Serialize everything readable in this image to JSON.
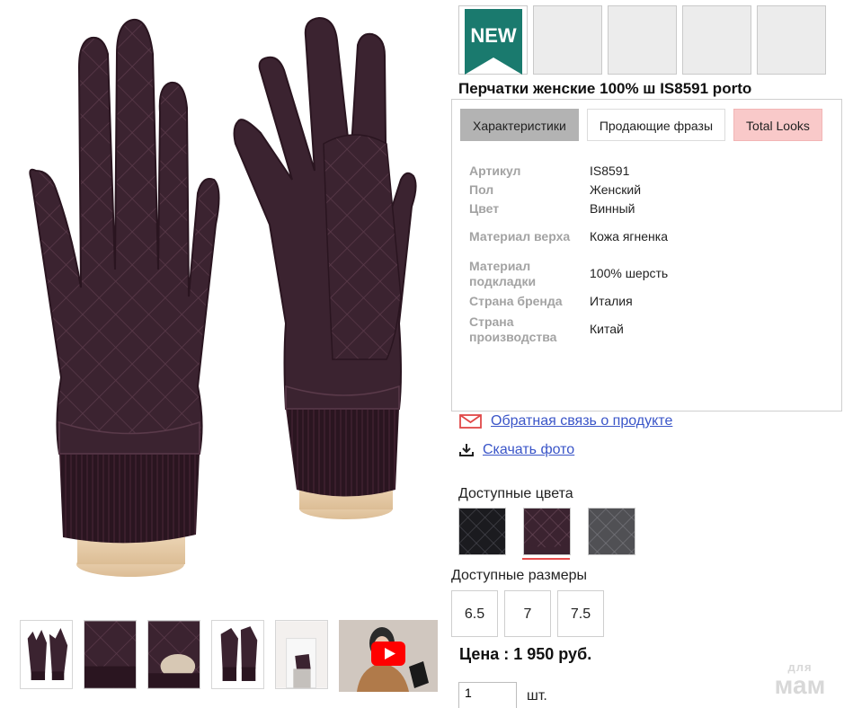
{
  "badges": {
    "new_label": "NEW"
  },
  "product": {
    "title": "Перчатки женские 100% ш IS8591 porto"
  },
  "tabs": [
    {
      "label": "Характеристики"
    },
    {
      "label": "Продающие фразы"
    },
    {
      "label": "Total Looks"
    }
  ],
  "specs": [
    {
      "key": "Артикул",
      "value": "IS8591"
    },
    {
      "key": "Пол",
      "value": "Женский"
    },
    {
      "key": "Цвет",
      "value": "Винный"
    },
    {
      "key": "Материал верха",
      "value": "Кожа ягненка"
    },
    {
      "key": "Материал подкладки",
      "value": "100% шерсть"
    },
    {
      "key": "Страна бренда",
      "value": "Италия"
    },
    {
      "key": "Страна производства",
      "value": "Китай"
    }
  ],
  "links": {
    "feedback": "Обратная связь о продукте",
    "download": "Скачать фото"
  },
  "colors_label": "Доступные цвета",
  "color_options": [
    "black",
    "wine",
    "grey"
  ],
  "sizes_label": "Доступные размеры",
  "sizes": [
    "6.5",
    "7",
    "7.5"
  ],
  "price": "Цена : 1 950 руб.",
  "quantity": {
    "value": "1",
    "unit": "шт."
  },
  "watermark": {
    "top": "для",
    "bottom": "мам"
  },
  "colors": {
    "brand_green": "#1a7a6e",
    "glove_wine": "#3b2330",
    "link": "#3a55c8",
    "tab_pink": "#f9c9c9",
    "tab_active": "#b3b3b3"
  }
}
